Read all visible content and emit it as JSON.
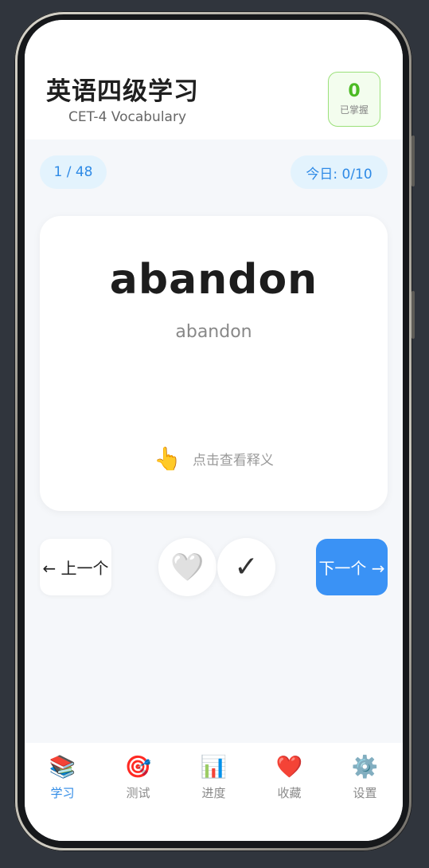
{
  "header": {
    "title": "英语四级学习",
    "subtitle": "CET-4 Vocabulary",
    "mastered_count": "0",
    "mastered_label": "已掌握"
  },
  "progress": {
    "counter": "1 / 48",
    "today": "今日: 0/10"
  },
  "card": {
    "word": "abandon",
    "phonetic": "abandon",
    "hint_icon": "👆",
    "hint_text": "点击查看释义"
  },
  "actions": {
    "prev_label": "← 上一个",
    "favorite_icon": "🤍",
    "mastered_icon": "✓",
    "next_label": "下一个 →"
  },
  "tabs": [
    {
      "icon": "📚",
      "label": "学习",
      "active": true
    },
    {
      "icon": "🎯",
      "label": "测试",
      "active": false
    },
    {
      "icon": "📊",
      "label": "进度",
      "active": false
    },
    {
      "icon": "❤️",
      "label": "收藏",
      "active": false
    },
    {
      "icon": "⚙️",
      "label": "设置",
      "active": false
    }
  ],
  "colors": {
    "accent": "#3a92f5",
    "mastered_green": "#4cbb24",
    "background": "#f5f7fa"
  }
}
